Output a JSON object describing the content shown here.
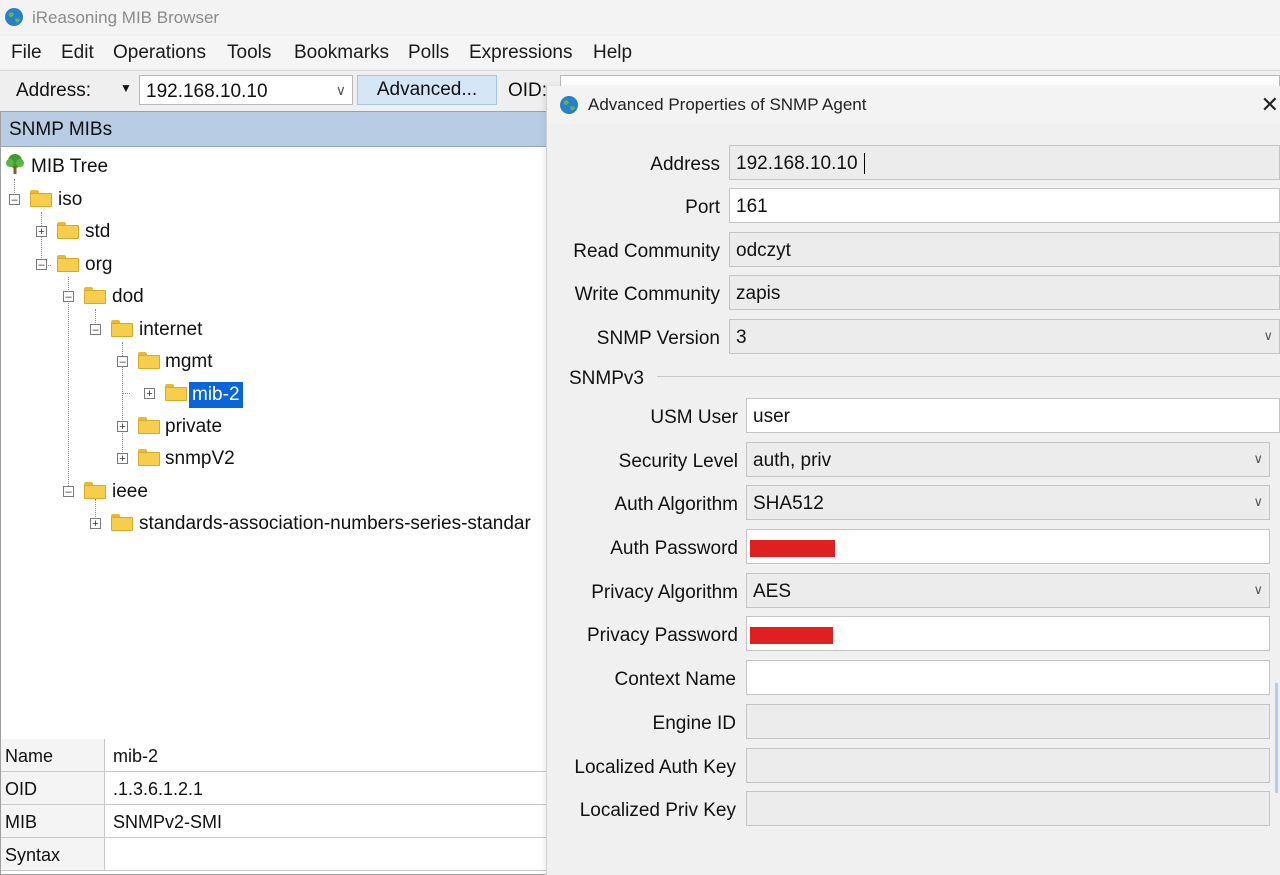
{
  "app": {
    "title": "iReasoning MIB Browser"
  },
  "menu": [
    "File",
    "Edit",
    "Operations",
    "Tools",
    "Bookmarks",
    "Polls",
    "Expressions",
    "Help"
  ],
  "toolbar": {
    "address_label": "Address:",
    "address_value": "192.168.10.10",
    "advanced_label": "Advanced...",
    "oid_label": "OID:"
  },
  "left_panel": {
    "header": "SNMP MIBs",
    "tree": {
      "root": "MIB Tree",
      "iso": "iso",
      "std": "std",
      "org": "org",
      "dod": "dod",
      "internet": "internet",
      "mgmt": "mgmt",
      "mib2": "mib-2",
      "private": "private",
      "snmpv2": "snmpV2",
      "ieee": "ieee",
      "standards": "standards-association-numbers-series-standar"
    },
    "properties": [
      {
        "name": "Name",
        "value": "mib-2"
      },
      {
        "name": "OID",
        "value": ".1.3.6.1.2.1"
      },
      {
        "name": "MIB",
        "value": "SNMPv2-SMI"
      },
      {
        "name": "Syntax",
        "value": ""
      }
    ]
  },
  "dialog": {
    "title": "Advanced Properties of SNMP Agent",
    "address": {
      "label": "Address",
      "value": "192.168.10.10"
    },
    "port": {
      "label": "Port",
      "value": "161"
    },
    "read_community": {
      "label": "Read Community",
      "value": "odczyt"
    },
    "write_community": {
      "label": "Write Community",
      "value": "zapis"
    },
    "snmp_version": {
      "label": "SNMP Version",
      "value": "3"
    },
    "snmpv3_section": "SNMPv3",
    "usm_user": {
      "label": "USM User",
      "value": "user"
    },
    "security_level": {
      "label": "Security Level",
      "value": "auth, priv"
    },
    "auth_algorithm": {
      "label": "Auth Algorithm",
      "value": "SHA512"
    },
    "auth_password": {
      "label": "Auth Password",
      "value": ""
    },
    "privacy_algorithm": {
      "label": "Privacy Algorithm",
      "value": "AES"
    },
    "privacy_password": {
      "label": "Privacy Password",
      "value": ""
    },
    "context_name": {
      "label": "Context Name",
      "value": ""
    },
    "engine_id": {
      "label": "Engine ID",
      "value": ""
    },
    "localized_auth_key": {
      "label": "Localized Auth Key",
      "value": ""
    },
    "localized_priv_key": {
      "label": "Localized Priv Key",
      "value": ""
    }
  },
  "colors": {
    "redaction": "#e02020",
    "selection": "#0a66d8",
    "panel_header": "#b8cde4",
    "advanced_button": "#d5e6f7"
  }
}
